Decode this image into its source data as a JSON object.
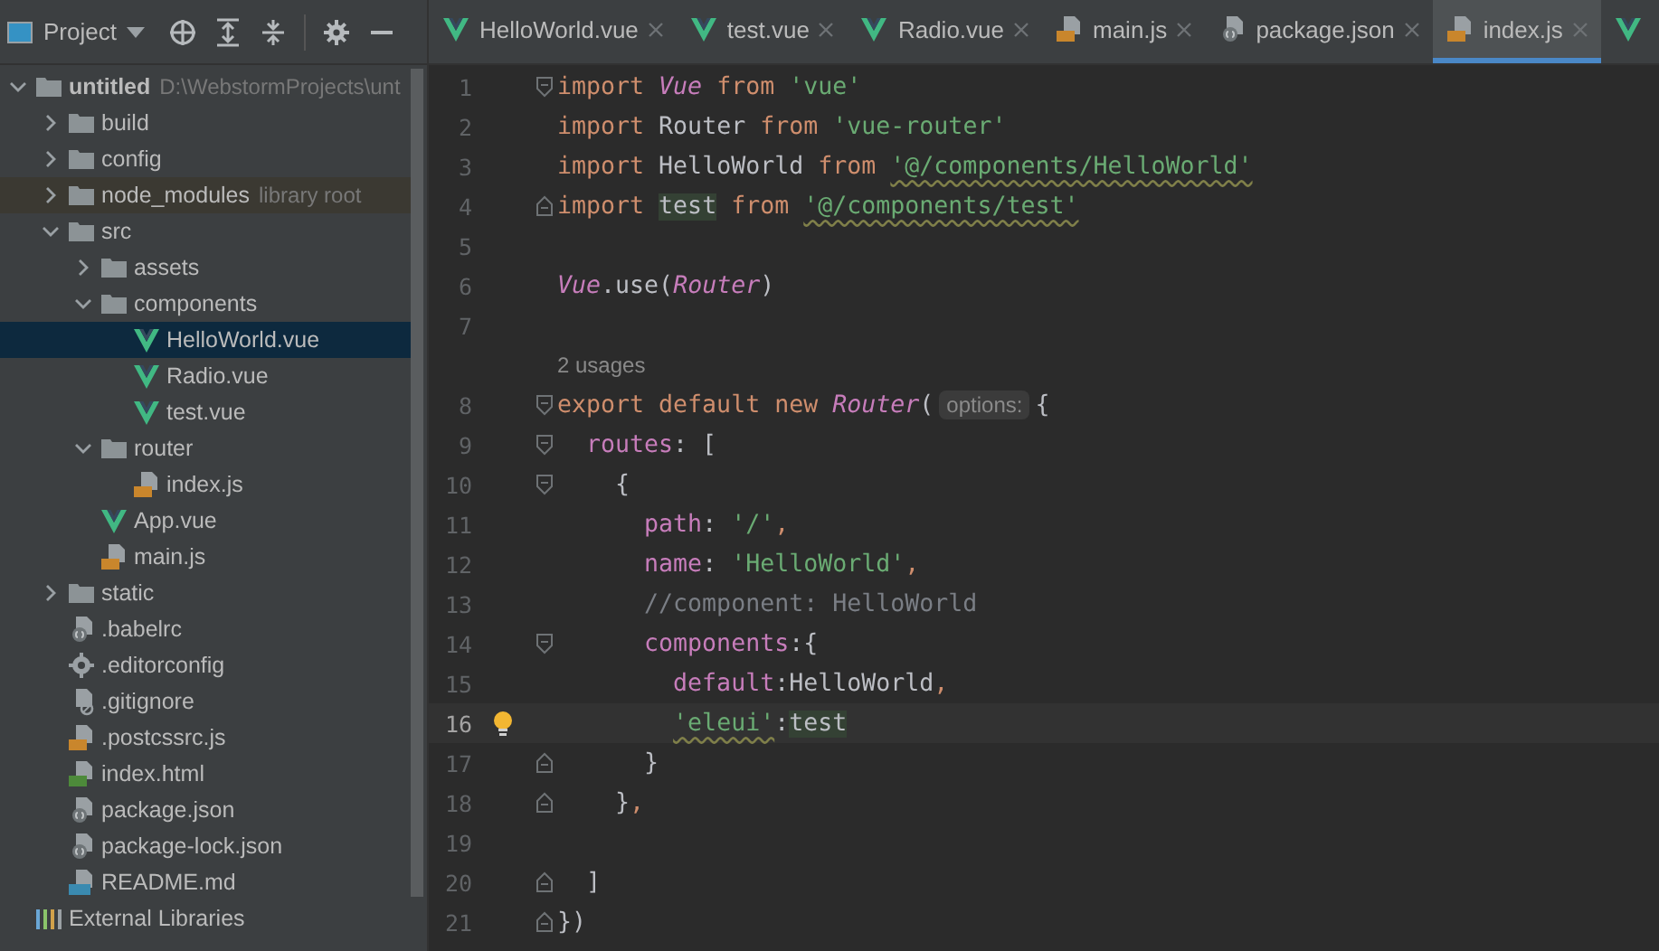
{
  "project_panel": {
    "title": "Project",
    "toolbar": [
      {
        "kind": "locate"
      },
      {
        "kind": "expand"
      },
      {
        "kind": "collapse"
      },
      {
        "kind": "settings"
      },
      {
        "kind": "minimize"
      }
    ],
    "tree": [
      {
        "label": "untitled",
        "kind": "folder",
        "bold": true,
        "path": "D:\\WebstormProjects\\unt",
        "expanded": true,
        "selected": false,
        "excluded": false,
        "children": [
          {
            "label": "build",
            "kind": "folder",
            "expanded": false,
            "selected": false,
            "excluded": false
          },
          {
            "label": "config",
            "kind": "folder",
            "expanded": false,
            "selected": false,
            "excluded": false
          },
          {
            "label": "node_modules",
            "kind": "folder",
            "note": "library root",
            "expanded": false,
            "selected": false,
            "excluded": true
          },
          {
            "label": "src",
            "kind": "folder",
            "expanded": true,
            "selected": false,
            "excluded": false,
            "children": [
              {
                "label": "assets",
                "kind": "folder",
                "expanded": false,
                "selected": false,
                "excluded": false
              },
              {
                "label": "components",
                "kind": "folder",
                "expanded": true,
                "selected": false,
                "excluded": false,
                "children": [
                  {
                    "label": "HelloWorld.vue",
                    "kind": "vue",
                    "selected": true,
                    "excluded": false
                  },
                  {
                    "label": "Radio.vue",
                    "kind": "vue",
                    "selected": false,
                    "excluded": false
                  },
                  {
                    "label": "test.vue",
                    "kind": "vue",
                    "selected": false,
                    "excluded": false
                  }
                ]
              },
              {
                "label": "router",
                "kind": "folder",
                "expanded": true,
                "selected": false,
                "excluded": false,
                "children": [
                  {
                    "label": "index.js",
                    "kind": "js",
                    "selected": false,
                    "excluded": false
                  }
                ]
              },
              {
                "label": "App.vue",
                "kind": "vue",
                "selected": false,
                "excluded": false
              },
              {
                "label": "main.js",
                "kind": "js",
                "selected": false,
                "excluded": false
              }
            ]
          },
          {
            "label": "static",
            "kind": "folder",
            "expanded": false,
            "selected": false,
            "excluded": false
          },
          {
            "label": ".babelrc",
            "kind": "json",
            "selected": false,
            "excluded": false
          },
          {
            "label": ".editorconfig",
            "kind": "config",
            "selected": false,
            "excluded": false
          },
          {
            "label": ".gitignore",
            "kind": "ignore",
            "selected": false,
            "excluded": false
          },
          {
            "label": ".postcssrc.js",
            "kind": "js",
            "selected": false,
            "excluded": false
          },
          {
            "label": "index.html",
            "kind": "html",
            "selected": false,
            "excluded": false
          },
          {
            "label": "package.json",
            "kind": "json",
            "selected": false,
            "excluded": false
          },
          {
            "label": "package-lock.json",
            "kind": "json",
            "selected": false,
            "excluded": false
          },
          {
            "label": "README.md",
            "kind": "md",
            "selected": false,
            "excluded": false
          }
        ]
      },
      {
        "label": "External Libraries",
        "kind": "libraries",
        "selected": false,
        "excluded": false
      }
    ]
  },
  "tabs": [
    {
      "label": "HelloWorld.vue",
      "kind": "vue",
      "selected": false
    },
    {
      "label": "test.vue",
      "kind": "vue",
      "selected": false
    },
    {
      "label": "Radio.vue",
      "kind": "vue",
      "selected": false
    },
    {
      "label": "main.js",
      "kind": "js",
      "selected": false
    },
    {
      "label": "package.json",
      "kind": "json",
      "selected": false
    },
    {
      "label": "index.js",
      "kind": "js",
      "selected": true
    },
    {
      "kind": "vue",
      "selected": false
    }
  ],
  "editor": {
    "lines": [
      {
        "kind": "code",
        "number": "1",
        "fold": {
          "kind": "start"
        },
        "current": false,
        "bulb": false,
        "tokens": [
          {
            "kind": "kw",
            "text": "import "
          },
          {
            "kind": "cls",
            "text": "Vue"
          },
          {
            "kind": "kw",
            "text": " from "
          },
          {
            "kind": "str",
            "text": "'vue'"
          }
        ]
      },
      {
        "kind": "code",
        "number": "2",
        "current": false,
        "bulb": false,
        "tokens": [
          {
            "kind": "kw",
            "text": "import "
          },
          {
            "kind": "id",
            "text": "Router"
          },
          {
            "kind": "kw",
            "text": " from "
          },
          {
            "kind": "str",
            "text": "'vue-router'"
          }
        ]
      },
      {
        "kind": "code",
        "number": "3",
        "current": false,
        "bulb": false,
        "tokens": [
          {
            "kind": "kw",
            "text": "import "
          },
          {
            "kind": "id",
            "text": "HelloWorld"
          },
          {
            "kind": "kw",
            "text": " from "
          },
          {
            "kind": "str",
            "text": "'@/components/HelloWorld'",
            "warning": true
          }
        ]
      },
      {
        "kind": "code",
        "number": "4",
        "fold": {
          "kind": "end"
        },
        "current": false,
        "bulb": false,
        "tokens": [
          {
            "kind": "kw",
            "text": "import "
          },
          {
            "kind": "id",
            "text": "test",
            "highlighted": true
          },
          {
            "kind": "kw",
            "text": " from "
          },
          {
            "kind": "str",
            "text": "'@/components/test'",
            "warning": true
          }
        ]
      },
      {
        "kind": "code",
        "number": "5",
        "current": false,
        "bulb": false
      },
      {
        "kind": "code",
        "number": "6",
        "current": false,
        "bulb": false,
        "tokens": [
          {
            "kind": "cls",
            "text": "Vue"
          },
          {
            "kind": "id",
            "text": ".use("
          },
          {
            "kind": "cls",
            "text": "Router"
          },
          {
            "kind": "id",
            "text": ")"
          }
        ]
      },
      {
        "kind": "code",
        "number": "7",
        "current": false,
        "bulb": false
      },
      {
        "kind": "usages",
        "text": "2 usages"
      },
      {
        "kind": "code",
        "number": "8",
        "fold": {
          "kind": "start"
        },
        "current": false,
        "bulb": false,
        "tokens": [
          {
            "kind": "kw",
            "text": "export default new "
          },
          {
            "kind": "cls",
            "text": "Router"
          },
          {
            "kind": "id",
            "text": "("
          },
          {
            "kind": "hint",
            "text": "options:"
          },
          {
            "kind": "id",
            "text": "{"
          }
        ]
      },
      {
        "kind": "code",
        "number": "9",
        "fold": {
          "kind": "start"
        },
        "current": false,
        "bulb": false,
        "tokens": [
          {
            "kind": "prop",
            "text": "  routes"
          },
          {
            "kind": "id",
            "text": ": ["
          }
        ]
      },
      {
        "kind": "code",
        "number": "10",
        "fold": {
          "kind": "start"
        },
        "current": false,
        "bulb": false,
        "tokens": [
          {
            "kind": "id",
            "text": "    {"
          }
        ]
      },
      {
        "kind": "code",
        "number": "11",
        "current": false,
        "bulb": false,
        "tokens": [
          {
            "kind": "prop",
            "text": "      path"
          },
          {
            "kind": "id",
            "text": ": "
          },
          {
            "kind": "str",
            "text": "'/'"
          },
          {
            "kind": "kw",
            "text": ","
          }
        ]
      },
      {
        "kind": "code",
        "number": "12",
        "current": false,
        "bulb": false,
        "tokens": [
          {
            "kind": "prop",
            "text": "      name"
          },
          {
            "kind": "id",
            "text": ": "
          },
          {
            "kind": "str",
            "text": "'HelloWorld'"
          },
          {
            "kind": "kw",
            "text": ","
          }
        ]
      },
      {
        "kind": "code",
        "number": "13",
        "current": false,
        "bulb": false,
        "tokens": [
          {
            "kind": "comment",
            "text": "      //component: HelloWorld"
          }
        ]
      },
      {
        "kind": "code",
        "number": "14",
        "fold": {
          "kind": "start"
        },
        "current": false,
        "bulb": false,
        "tokens": [
          {
            "kind": "prop",
            "text": "      components"
          },
          {
            "kind": "id",
            "text": ":{"
          }
        ]
      },
      {
        "kind": "code",
        "number": "15",
        "current": false,
        "bulb": false,
        "tokens": [
          {
            "kind": "prop",
            "text": "        default"
          },
          {
            "kind": "id",
            "text": ":HelloWorld"
          },
          {
            "kind": "kw",
            "text": ","
          }
        ]
      },
      {
        "kind": "code",
        "number": "16",
        "current": true,
        "bulb": true,
        "tokens": [
          {
            "kind": "str",
            "text": "        'eleui'",
            "warning": true
          },
          {
            "kind": "id",
            "text": ":"
          },
          {
            "kind": "id",
            "text": "test",
            "highlighted": true
          }
        ]
      },
      {
        "kind": "code",
        "number": "17",
        "fold": {
          "kind": "end"
        },
        "current": false,
        "bulb": false,
        "tokens": [
          {
            "kind": "id",
            "text": "      }"
          }
        ]
      },
      {
        "kind": "code",
        "number": "18",
        "fold": {
          "kind": "end"
        },
        "current": false,
        "bulb": false,
        "tokens": [
          {
            "kind": "id",
            "text": "    }"
          },
          {
            "kind": "kw",
            "text": ","
          }
        ]
      },
      {
        "kind": "code",
        "number": "19",
        "current": false,
        "bulb": false
      },
      {
        "kind": "code",
        "number": "20",
        "fold": {
          "kind": "end"
        },
        "current": false,
        "bulb": false,
        "tokens": [
          {
            "kind": "id",
            "text": "  ]"
          }
        ]
      },
      {
        "kind": "code",
        "number": "21",
        "fold": {
          "kind": "end"
        },
        "current": false,
        "bulb": false,
        "tokens": [
          {
            "kind": "id",
            "text": "})"
          }
        ]
      }
    ]
  }
}
